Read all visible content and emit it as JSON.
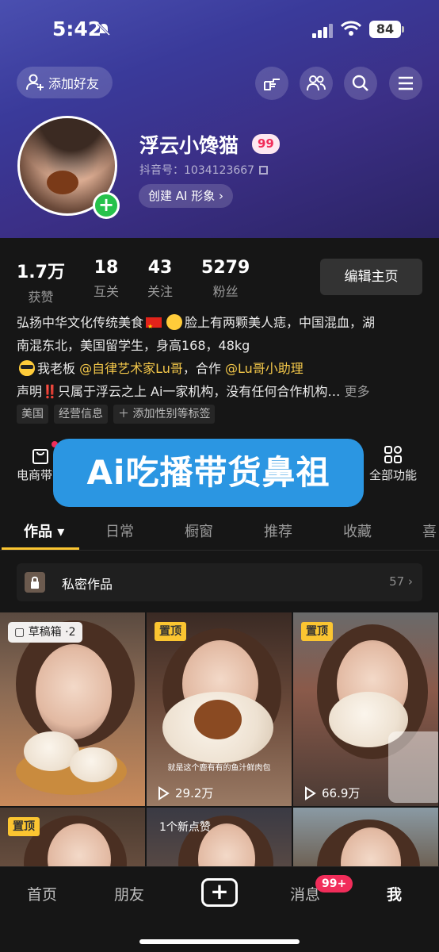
{
  "status_bar": {
    "time": "5:42",
    "battery": "84"
  },
  "header": {
    "add_friend_label": "添加好友"
  },
  "profile": {
    "name": "浮云小馋猫",
    "level": "99",
    "douyin_id_label": "抖音号：",
    "douyin_id": "1034123667",
    "ai_button": "创建 AI 形象 ›"
  },
  "stats": [
    {
      "value": "1.7万",
      "label": "获赞"
    },
    {
      "value": "18",
      "label": "互关"
    },
    {
      "value": "43",
      "label": "关注"
    },
    {
      "value": "5279",
      "label": "粉丝"
    }
  ],
  "edit_button": "编辑主页",
  "bio": {
    "line1_a": "弘扬中华文化传统美食",
    "line1_b": "脸上有两颗美人痣，中国混血，湖",
    "line2": "南混东北，美国留学生，身高168，48kg",
    "line3_a": "我老板 ",
    "line3_link1": "@自律艺术家Lu哥",
    "line3_b": "，合作 ",
    "line3_link2": "@Lu哥小助理",
    "line4_a": "声明",
    "line4_bang": "‼️",
    "line4_b": "只属于浮云之上 Ai一家机构，没有任何合作机构…",
    "more": "更多"
  },
  "tags": [
    "美国",
    "经营信息",
    "＋ 添加性别等标签"
  ],
  "shortcuts": {
    "left_label": "电商带货",
    "right_label": "全部功能"
  },
  "banner": "Ai吃播带货鼻祖",
  "tabs": [
    "作品 ▾",
    "日常",
    "橱窗",
    "推荐",
    "收藏",
    "喜"
  ],
  "private": {
    "label": "私密作品",
    "count": "57 ›"
  },
  "grid": {
    "draft": "草稿箱 ·2",
    "pinned": "置顶",
    "plays_2": "29.2万",
    "plays_3": "66.9万",
    "subtitle_2": "就是这个鹿有有的鱼汁鲜肉包",
    "new_likes": "1个新点赞"
  },
  "nav": {
    "home": "首页",
    "friends": "朋友",
    "messages": "消息",
    "msg_badge": "99+",
    "me": "我"
  },
  "colors": {
    "accent_yellow": "#fbc531",
    "badge_red": "#f12d5a",
    "banner_blue": "#2b96e2",
    "add_green": "#27c24c"
  }
}
